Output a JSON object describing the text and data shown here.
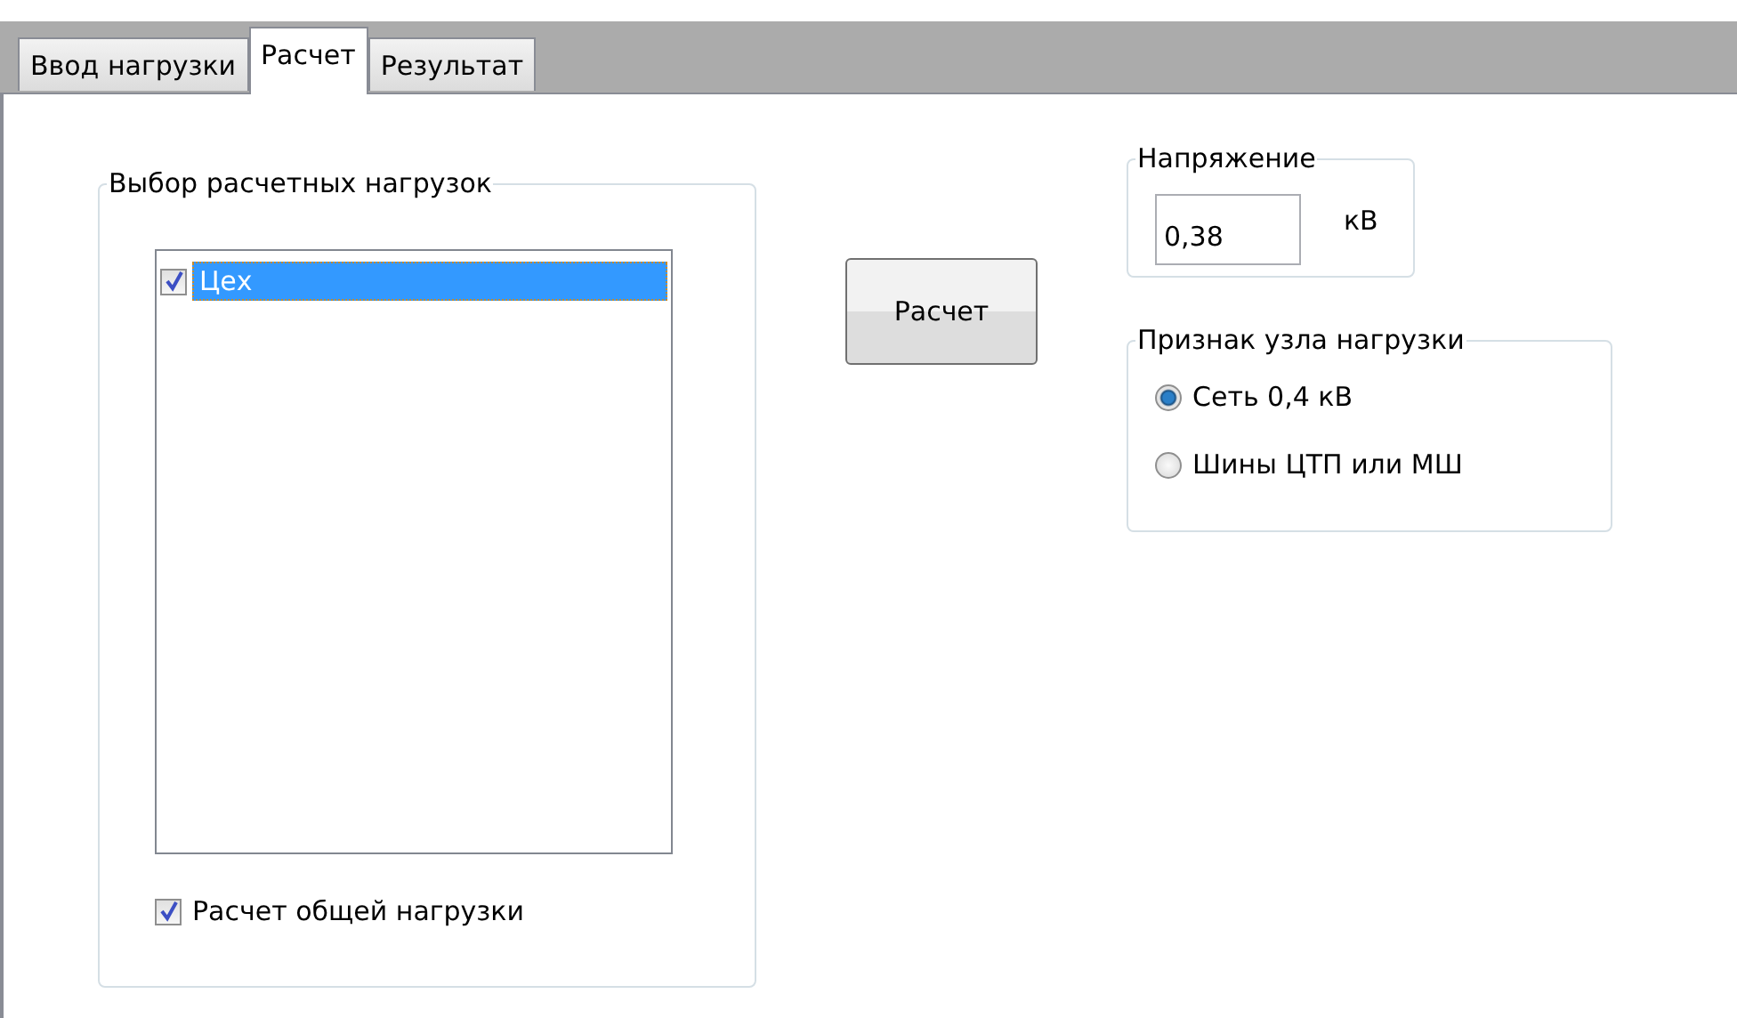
{
  "tabs": [
    {
      "label": "Ввод нагрузки",
      "selected": false
    },
    {
      "label": "Расчет",
      "selected": true
    },
    {
      "label": "Результат",
      "selected": false
    }
  ],
  "loads_group": {
    "title": "Выбор расчетных нагрузок",
    "items": [
      {
        "label": "Цех",
        "checked": true,
        "selected": true
      }
    ],
    "total_checkbox": {
      "label": "Расчет общей нагрузки",
      "checked": true
    }
  },
  "calc_button": "Расчет",
  "voltage_group": {
    "title": "Напряжение",
    "value": "0,38",
    "unit": "кВ"
  },
  "node_group": {
    "title": "Признак узла нагрузки",
    "options": [
      {
        "label": "Сеть 0,4 кВ",
        "selected": true
      },
      {
        "label": "Шины ЦТП или МШ",
        "selected": false
      }
    ]
  }
}
